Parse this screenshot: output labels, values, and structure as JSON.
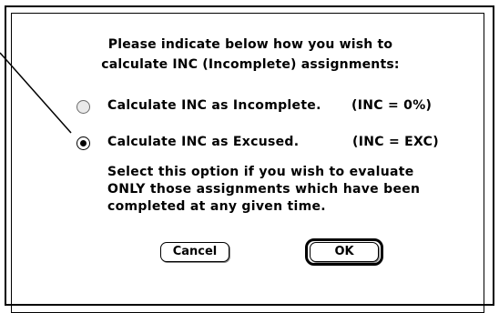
{
  "dialog": {
    "prompt_line1": "Please indicate below how you wish to",
    "prompt_line2": "calculate INC (Incomplete) assignments:",
    "options": [
      {
        "label": "Calculate INC as Incomplete.",
        "code": "(INC = 0%)",
        "selected": false
      },
      {
        "label": "Calculate INC as Excused.",
        "code": "(INC = EXC)",
        "selected": true
      }
    ],
    "description": [
      "Select this option if you wish to evaluate",
      "ONLY those assignments which have been",
      "completed at any given time."
    ],
    "cancel_label": "Cancel",
    "ok_label": "OK"
  }
}
